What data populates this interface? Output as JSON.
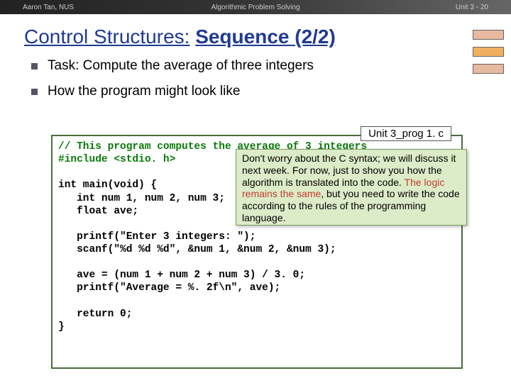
{
  "header": {
    "left": "Aaron Tan, NUS",
    "mid": "Algorithmic Problem Solving",
    "right": "Unit 3 - 20"
  },
  "title": {
    "part1": "Control Structures:",
    "part2": "Sequence (2/2)"
  },
  "bullets": {
    "b1": "Task: Compute the average of three integers",
    "b2": "How the program might look like"
  },
  "filename": "Unit 3_prog 1. c",
  "code": {
    "l1": "// This program computes the average of 3 integers",
    "l2": "#include <stdio. h>",
    "l3": "",
    "l4": "int main(void) {",
    "l5": "   int num 1, num 2, num 3;",
    "l6": "   float ave;",
    "l7": "",
    "l8": "   printf(\"Enter 3 integers: \");",
    "l9": "   scanf(\"%d %d %d\", &num 1, &num 2, &num 3);",
    "l10": "",
    "l11": "   ave = (num 1 + num 2 + num 3) / 3. 0;",
    "l12": "   printf(\"Average = %. 2f\\n\", ave);",
    "l13": "",
    "l14": "   return 0;",
    "l15": "}"
  },
  "note": {
    "p1": "Don't worry about the C syntax; we will discuss it next week. For now, just to show you how the algorithm is translated into the code. ",
    "em": "The logic remains the same",
    "p2": ", but you need to write the code according to the rules of the programming language."
  }
}
